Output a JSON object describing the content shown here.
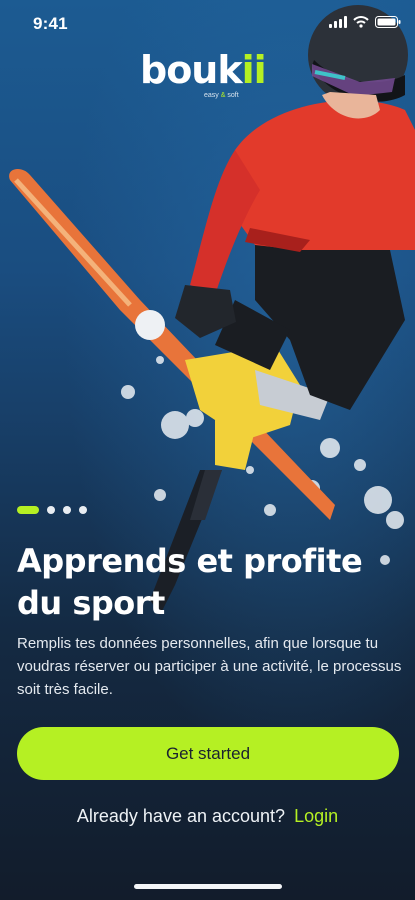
{
  "status_bar": {
    "time": "9:41"
  },
  "brand": {
    "name_main": "bouk",
    "name_accent": "ii",
    "tagline_pre": "easy",
    "tagline_amp": "&",
    "tagline_post": "soft"
  },
  "hero": {
    "image": "skier-jump"
  },
  "pager": {
    "total": 4,
    "active_index": 0
  },
  "onboarding": {
    "headline": "Apprends et profite du sport",
    "description": "Remplis tes données personnelles, afin que lorsque tu voudras réserver ou participer à une activité, le processus soit très facile."
  },
  "actions": {
    "primary_label": "Get started",
    "account_prompt": "Already have an account?",
    "login_label": "Login"
  },
  "colors": {
    "accent": "#b5f023",
    "background_top": "#1c5b92",
    "background_bottom": "#121c2b"
  }
}
